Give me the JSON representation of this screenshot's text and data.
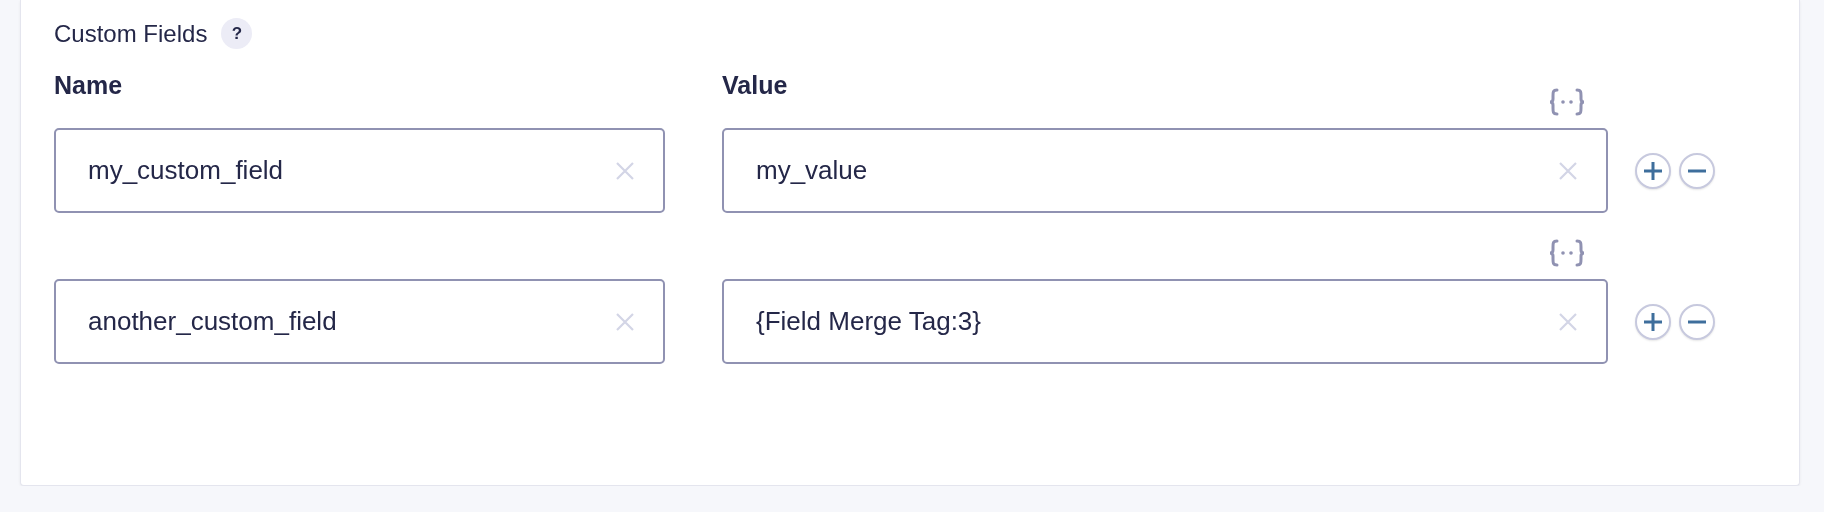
{
  "section": {
    "title": "Custom Fields",
    "help": "?"
  },
  "columns": [
    "Name",
    "Value"
  ],
  "rows": [
    {
      "name": "my_custom_field",
      "value": "my_value"
    },
    {
      "name": "another_custom_field",
      "value": "{Field Merge Tag:3}"
    }
  ]
}
